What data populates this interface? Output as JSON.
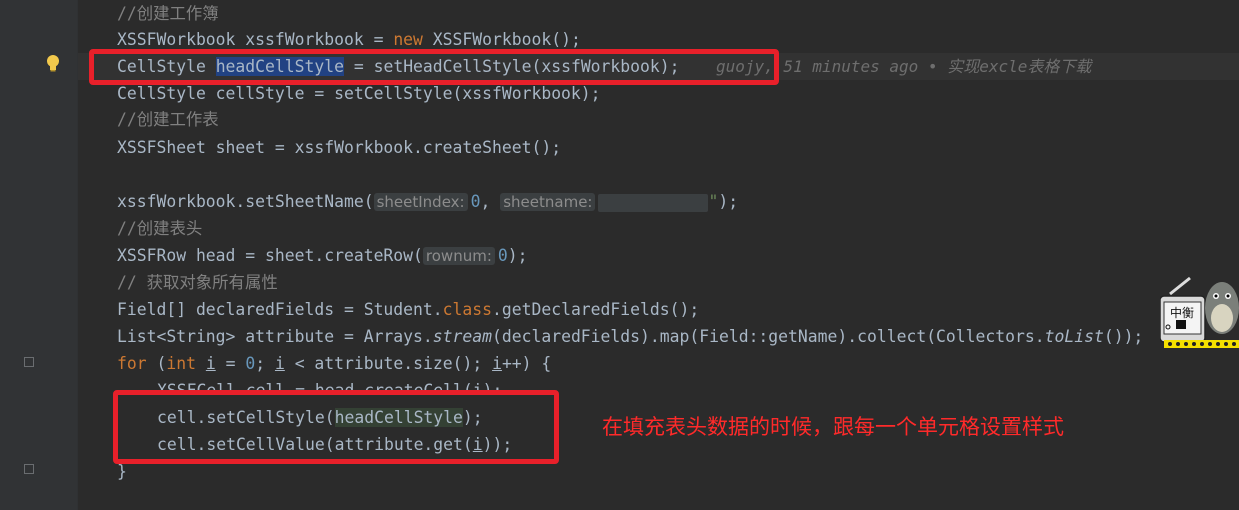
{
  "code": {
    "l1_comment": "//创建工作簿",
    "l2_a": "XSSFWorkbook xssfWorkbook = ",
    "l2_new": "new",
    "l2_b": " XSSFWorkbook();",
    "l3_type": "CellStyle ",
    "l3_var": "headCellStyle",
    "l3_rest": " = setHeadCellStyle(xssfWorkbook);",
    "l4": "CellStyle cellStyle = setCellStyle(xssfWorkbook);",
    "l5_comment": "//创建工作表",
    "l6": "XSSFSheet sheet = xssfWorkbook.createSheet();",
    "l8_a": "xssfWorkbook.setSheetName(",
    "l8_hint1": "sheetIndex:",
    "l8_num": "0",
    "l8_comma": ", ",
    "l8_hint2": "sheetname:",
    "l8_str_end": "\"",
    "l8_end": ");",
    "l9_comment": "//创建表头",
    "l10_a": "XSSFRow head = sheet.createRow(",
    "l10_hint": "rownum:",
    "l10_num": "0",
    "l10_end": ");",
    "l11_comment": "// 获取对象所有属性",
    "l12_a": "Field[] declaredFields = Student.",
    "l12_class": "class",
    "l12_b": ".getDeclaredFields();",
    "l13_a": "List<String> attribute = Arrays.",
    "l13_stream": "stream",
    "l13_b": "(declaredFields).map(Field::getName).collect(Collectors.",
    "l13_tolist": "toList",
    "l13_c": "());",
    "l14_for": "for",
    "l14_a": " (",
    "l14_int": "int",
    "l14_sp": " ",
    "l14_i1": "i",
    "l14_b": " = ",
    "l14_zero": "0",
    "l14_c": "; ",
    "l14_i2": "i",
    "l14_d": " < attribute.size(); ",
    "l14_i3": "i",
    "l14_e": "++) {",
    "l15": "XSSFCell cell = head.createCell(i);",
    "l16_a": "cell.setCellStyle(",
    "l16_var": "headCellStyle",
    "l16_b": ");",
    "l17_a": "cell.setCellValue(attribute.get(",
    "l17_i": "i",
    "l17_b": "));",
    "l18": "}"
  },
  "blame": "guojy, 51 minutes ago • 实现excle表格下载",
  "annotation": "在填充表头数据的时候，跟每一个单元格设置样式",
  "sticker": {
    "label": "中衡",
    "icon": "totoro-sticker-icon"
  },
  "colors": {
    "background": "#2b2b2b",
    "keyword": "#cc7832",
    "number": "#6897bb",
    "comment": "#808080",
    "annotation_red": "#ff2a2a"
  }
}
